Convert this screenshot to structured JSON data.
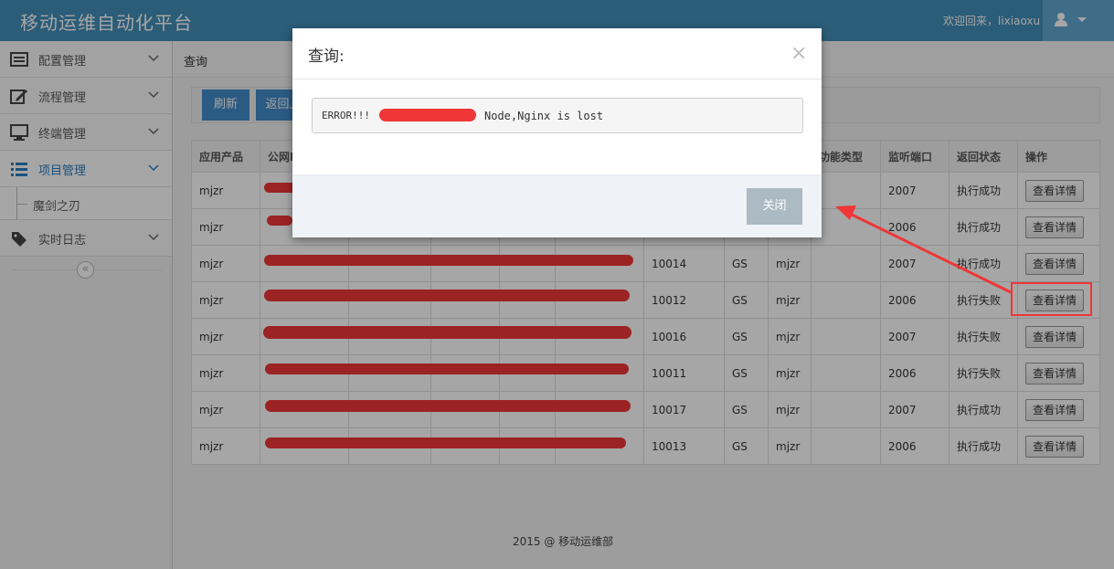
{
  "app": {
    "title": "移动运维自动化平台",
    "welcome": "欢迎回来，lixiaoxu"
  },
  "sidebar": {
    "items": [
      {
        "label": "配置管理",
        "icon": "list-box-icon"
      },
      {
        "label": "流程管理",
        "icon": "edit-icon"
      },
      {
        "label": "终端管理",
        "icon": "desktop-icon"
      },
      {
        "label": "项目管理",
        "icon": "list-icon",
        "active": true
      },
      {
        "label": "实时日志",
        "icon": "tag-icon"
      }
    ],
    "sub_item": "魔剑之刃",
    "collapse_glyph": "«"
  },
  "breadcrumb": "查询",
  "toolbar": {
    "refresh": "刷新",
    "back": "返回上"
  },
  "table": {
    "headers": [
      "应用产品",
      "公网IP",
      "",
      "",
      "",
      "",
      "",
      "",
      "",
      "功能类型",
      "监听端口",
      "返回状态",
      "操作"
    ],
    "rows": [
      {
        "product": "mjzr",
        "c7": "",
        "c8": "",
        "c9": "",
        "port": "2007",
        "status": "执行成功",
        "ok": true
      },
      {
        "product": "mjzr",
        "c7": "",
        "c8": "",
        "c9": "",
        "port": "2006",
        "status": "执行成功",
        "ok": true
      },
      {
        "product": "mjzr",
        "c7": "10014",
        "c8": "GS",
        "c9": "mjzr",
        "port": "2007",
        "status": "执行成功",
        "ok": true
      },
      {
        "product": "mjzr",
        "c7": "10012",
        "c8": "GS",
        "c9": "mjzr",
        "port": "2006",
        "status": "执行失败",
        "ok": false
      },
      {
        "product": "mjzr",
        "c7": "10016",
        "c8": "GS",
        "c9": "mjzr",
        "port": "2007",
        "status": "执行失败",
        "ok": false
      },
      {
        "product": "mjzr",
        "c7": "10011",
        "c8": "GS",
        "c9": "mjzr",
        "port": "2006",
        "status": "执行失败",
        "ok": false
      },
      {
        "product": "mjzr",
        "c7": "10017",
        "c8": "GS",
        "c9": "mjzr",
        "port": "2007",
        "status": "执行成功",
        "ok": true
      },
      {
        "product": "mjzr",
        "c7": "10013",
        "c8": "GS",
        "c9": "mjzr",
        "port": "2006",
        "status": "执行成功",
        "ok": true
      }
    ],
    "action_label": "查看详情"
  },
  "footer": "2015 @ 移动运维部",
  "modal": {
    "title": "查询:",
    "close_glyph": "×",
    "message_prefix": "ERROR!!!",
    "message_suffix": "Node,Nginx is lost",
    "close_button": "关闭"
  },
  "colors": {
    "navbar": "#438eb9",
    "primary": "#428bca",
    "success": "#1f8a1f",
    "fail": "#c0392b",
    "annotation": "#f03636"
  }
}
